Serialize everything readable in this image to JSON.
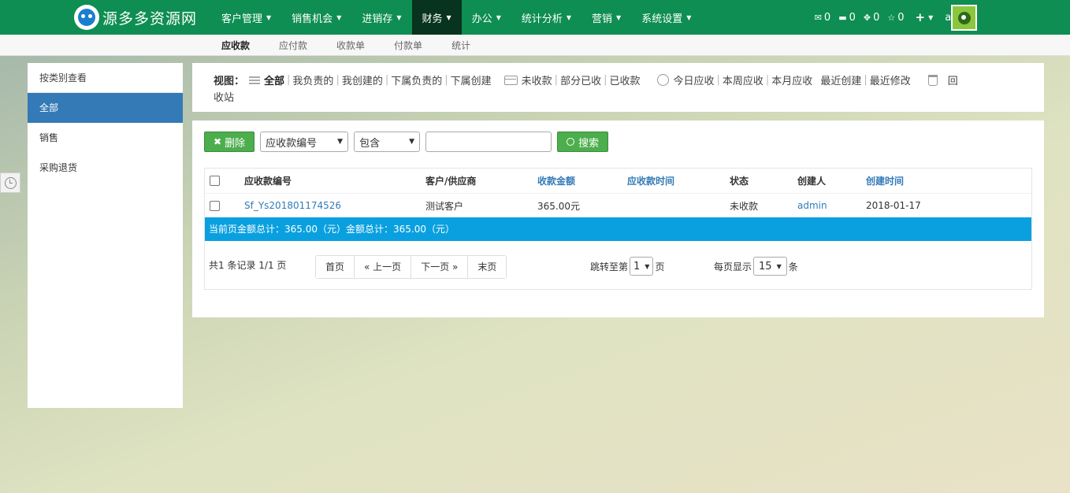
{
  "brand": {
    "title": "源多多资源网"
  },
  "nav": [
    {
      "label": "客户管理",
      "active": false
    },
    {
      "label": "销售机会",
      "active": false
    },
    {
      "label": "进销存",
      "active": false
    },
    {
      "label": "财务",
      "active": true
    },
    {
      "label": "办公",
      "active": false
    },
    {
      "label": "统计分析",
      "active": false
    },
    {
      "label": "营销",
      "active": false
    },
    {
      "label": "系统设置",
      "active": false
    }
  ],
  "top_right": {
    "mail_count": "0",
    "task_count": "0",
    "event_count": "0",
    "star_count": "0",
    "add_icon": "plus-icon",
    "user": "admin"
  },
  "subnav": [
    "应收款",
    "应付款",
    "收款单",
    "付款单",
    "统计"
  ],
  "subnav_active": "应收款",
  "left_panel": {
    "header": "按类别查看",
    "items": [
      "全部",
      "销售",
      "采购退货"
    ],
    "active": "全部"
  },
  "view": {
    "label": "视图：",
    "group1": [
      "全部",
      "我负责的",
      "我创建的",
      "下属负责的",
      "下属创建"
    ],
    "group2": [
      "未收款",
      "部分已收",
      "已收款"
    ],
    "group3": [
      "今日应收",
      "本周应收",
      "本月应收"
    ],
    "group4": [
      "最近创建",
      "最近修改"
    ],
    "recycle": "回",
    "recycle_wrap": "收站"
  },
  "toolbar": {
    "delete_label": "删除",
    "field_select": "应收款编号",
    "condition_select": "包含",
    "search_value": "",
    "search_label": "搜索"
  },
  "table": {
    "columns": [
      "应收款编号",
      "客户/供应商",
      "收款金额",
      "应收款时间",
      "状态",
      "创建人",
      "创建时间"
    ],
    "rows": [
      {
        "code": "Sf_Ys201801174526",
        "customer": "测试客户",
        "amount": "365.00元",
        "due_time": "",
        "status": "未收款",
        "creator": "admin",
        "created": "2018-01-17"
      }
    ],
    "summary": "当前页金额总计：365.00（元）金额总计：365.00（元）"
  },
  "pager": {
    "info": "共1 条记录 1/1 页",
    "first": "首页",
    "prev": "« 上一页",
    "next": "下一页 »",
    "last": "末页",
    "jump_label": "跳转至第",
    "jump_value": "1",
    "jump_unit": "页",
    "per_label": "每页显示",
    "per_value": "15",
    "per_unit": "条"
  },
  "colors": {
    "topbar": "#0e8e52",
    "active_nav": "#08331e",
    "accent_blue": "#337ab7",
    "summary_bar": "#0aa0e0",
    "btn_green": "#4cae4c"
  }
}
